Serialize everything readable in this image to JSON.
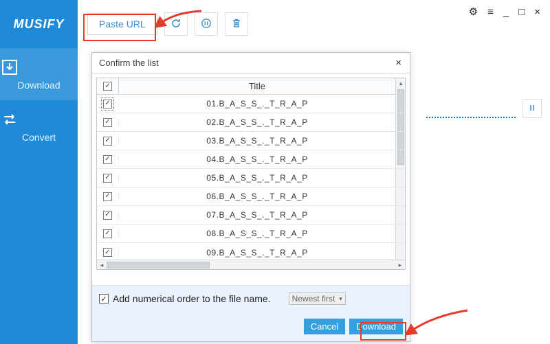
{
  "brand": "MUSIFY",
  "sidebar": {
    "download_label": "Download",
    "convert_label": "Convert"
  },
  "toolbar": {
    "paste_label": "Paste URL"
  },
  "window_controls": {
    "gear": "⚙",
    "menu": "≡",
    "minimize": "_",
    "maximize": "□",
    "close": "×"
  },
  "dialog": {
    "title": "Confirm the list",
    "close": "×",
    "column_title": "Title",
    "rows": [
      "01.B_A_S_S_._T_R_A_P",
      "02.B_A_S_S_._T_R_A_P",
      "03.B_A_S_S_._T_R_A_P",
      "04.B_A_S_S_._T_R_A_P",
      "05.B_A_S_S_._T_R_A_P",
      "06.B_A_S_S_._T_R_A_P",
      "07.B_A_S_S_._T_R_A_P",
      "08.B_A_S_S_._T_R_A_P",
      "09.B_A_S_S_._T_R_A_P"
    ],
    "numerical_label": "Add numerical order to the file name.",
    "sort_label": "Newest first",
    "cancel_label": "Cancel",
    "download_label": "Download"
  }
}
